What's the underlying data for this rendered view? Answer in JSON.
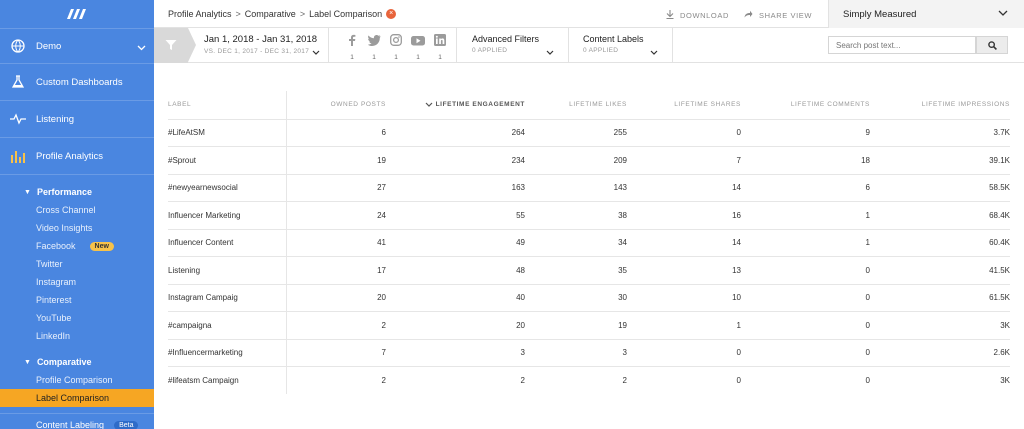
{
  "sidebar": {
    "workspace": "Demo",
    "nav": [
      {
        "label": "Custom Dashboards",
        "icon": "flask-icon"
      },
      {
        "label": "Listening",
        "icon": "pulse-icon"
      },
      {
        "label": "Profile Analytics",
        "icon": "bar-chart-icon"
      }
    ],
    "performance": {
      "title": "Performance",
      "items": [
        "Cross Channel",
        "Video Insights",
        "Facebook",
        "Twitter",
        "Instagram",
        "Pinterest",
        "YouTube",
        "LinkedIn"
      ],
      "facebook_badge": "New"
    },
    "comparative": {
      "title": "Comparative",
      "items": [
        "Profile Comparison",
        "Label Comparison"
      ]
    },
    "content_labeling": "Content Labeling",
    "content_labeling_badge": "Beta"
  },
  "header": {
    "breadcrumb": [
      "Profile Analytics",
      "Comparative",
      "Label Comparison"
    ],
    "download": "DOWNLOAD",
    "share": "SHARE VIEW",
    "account": "Simply Measured"
  },
  "filters": {
    "date_range": "Jan 1, 2018 - Jan 31, 2018",
    "compare_range": "VS. DEC 1, 2017 - DEC 31, 2017",
    "networks": [
      {
        "icon": "facebook-icon",
        "count": "1"
      },
      {
        "icon": "twitter-icon",
        "count": "1"
      },
      {
        "icon": "instagram-icon",
        "count": "1"
      },
      {
        "icon": "youtube-icon",
        "count": "1"
      },
      {
        "icon": "linkedin-icon",
        "count": "1"
      }
    ],
    "advanced": {
      "title": "Advanced Filters",
      "status": "0 APPLIED"
    },
    "content_labels": {
      "title": "Content Labels",
      "status": "0 APPLIED"
    },
    "search_placeholder": "Search post text..."
  },
  "table": {
    "headers": [
      "LABEL",
      "OWNED POSTS",
      "LIFETIME ENGAGEMENT",
      "LIFETIME LIKES",
      "LIFETIME SHARES",
      "LIFETIME COMMENTS",
      "LIFETIME IMPRESSIONS"
    ],
    "rows": [
      [
        "#LifeAtSM",
        "6",
        "264",
        "255",
        "0",
        "9",
        "3.7K"
      ],
      [
        "#Sprout",
        "19",
        "234",
        "209",
        "7",
        "18",
        "39.1K"
      ],
      [
        "#newyearnewsocial",
        "27",
        "163",
        "143",
        "14",
        "6",
        "58.5K"
      ],
      [
        "Influencer Marketing",
        "24",
        "55",
        "38",
        "16",
        "1",
        "68.4K"
      ],
      [
        "Influencer Content",
        "41",
        "49",
        "34",
        "14",
        "1",
        "60.4K"
      ],
      [
        "Listening",
        "17",
        "48",
        "35",
        "13",
        "0",
        "41.5K"
      ],
      [
        "Instagram Campaig",
        "20",
        "40",
        "30",
        "10",
        "0",
        "61.5K"
      ],
      [
        "#campaigna",
        "2",
        "20",
        "19",
        "1",
        "0",
        "3K"
      ],
      [
        "#Influencermarketing",
        "7",
        "3",
        "3",
        "0",
        "0",
        "2.6K"
      ],
      [
        "#lifeatsm Campaign",
        "2",
        "2",
        "2",
        "0",
        "0",
        "3K"
      ]
    ]
  },
  "colors": {
    "sidebar": "#4a86e0",
    "active": "#f6a623",
    "badge_new": "#f7c24a",
    "breadcrumb_badge": "#e8643b"
  }
}
